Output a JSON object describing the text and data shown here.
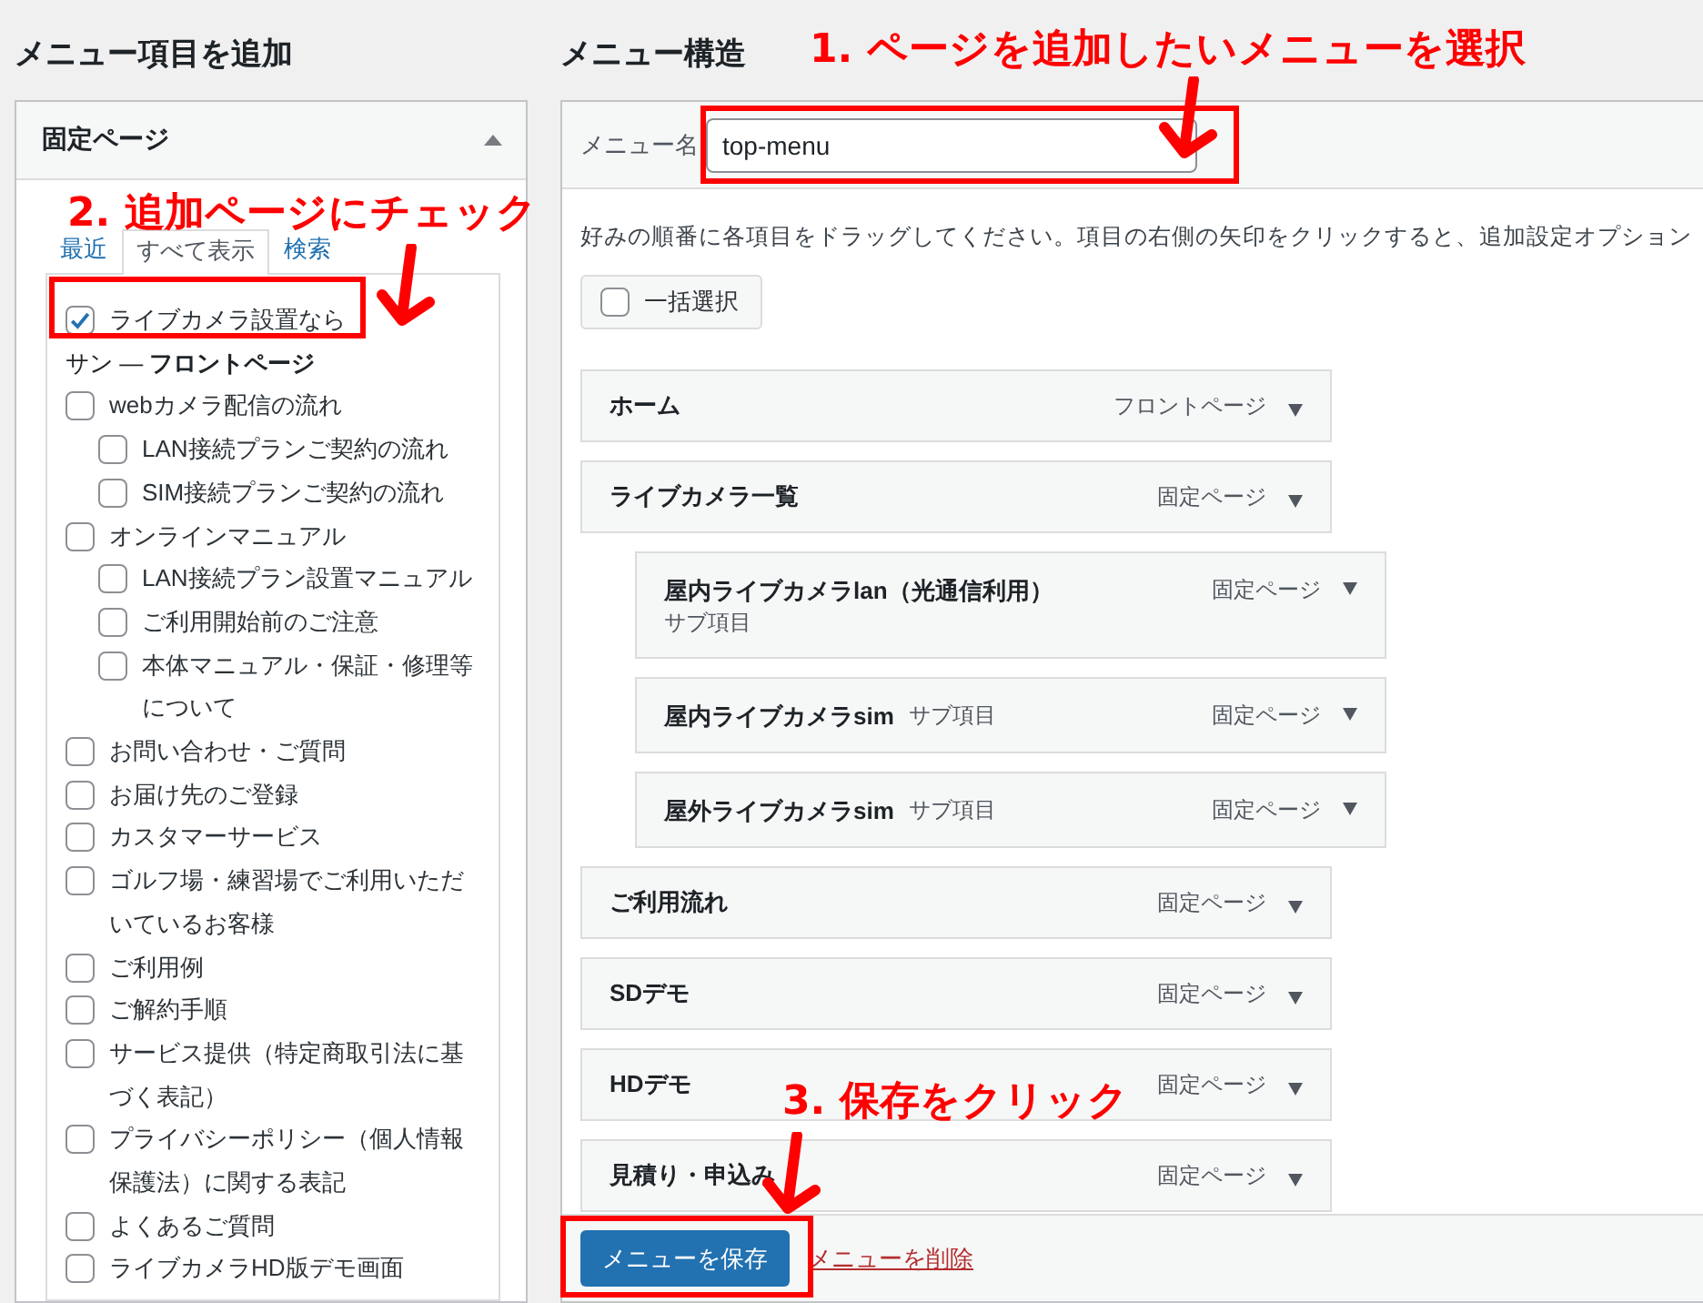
{
  "add_panel": {
    "heading": "メニュー項目を追加",
    "section": {
      "title": "固定ページ",
      "expanded": true
    },
    "tabs": [
      {
        "label": "最近",
        "selected": false
      },
      {
        "label": "すべて表示",
        "selected": true
      },
      {
        "label": "検索",
        "selected": false
      }
    ],
    "pages": [
      {
        "kind": "checkbox",
        "label": "ライブカメラ設置なら",
        "checked": true
      },
      {
        "kind": "note",
        "label": "サン — **フロントページ**"
      },
      {
        "kind": "checkbox",
        "label": "webカメラ配信の流れ",
        "checked": false,
        "children": [
          {
            "kind": "checkbox",
            "label": "LAN接続プランご契約の流れ",
            "checked": false
          },
          {
            "kind": "checkbox",
            "label": "SIM接続プランご契約の流れ",
            "checked": false
          }
        ]
      },
      {
        "kind": "checkbox",
        "label": "オンラインマニュアル",
        "checked": false,
        "children": [
          {
            "kind": "checkbox",
            "label": "LAN接続プラン設置マニュアル",
            "checked": false
          },
          {
            "kind": "checkbox",
            "label": "ご利用開始前のご注意",
            "checked": false
          },
          {
            "kind": "checkbox",
            "label": "本体マニュアル・保証・修理等について",
            "checked": false
          }
        ]
      },
      {
        "kind": "checkbox",
        "label": "お問い合わせ・ご質問",
        "checked": false
      },
      {
        "kind": "checkbox",
        "label": "お届け先のご登録",
        "checked": false
      },
      {
        "kind": "checkbox",
        "label": "カスタマーサービス",
        "checked": false
      },
      {
        "kind": "checkbox",
        "label": "ゴルフ場・練習場でご利用いただいているお客様",
        "checked": false
      },
      {
        "kind": "checkbox",
        "label": "ご利用例",
        "checked": false
      },
      {
        "kind": "checkbox",
        "label": "ご解約手順",
        "checked": false
      },
      {
        "kind": "checkbox",
        "label": "サービス提供（特定商取引法に基づく表記）",
        "checked": false
      },
      {
        "kind": "checkbox",
        "label": "プライバシーポリシー（個人情報保護法）に関する表記",
        "checked": false
      },
      {
        "kind": "checkbox",
        "label": "よくあるご質問",
        "checked": false
      },
      {
        "kind": "checkbox",
        "label": "ライブカメラHD版デモ画面",
        "checked": false
      }
    ]
  },
  "structure": {
    "heading": "メニュー構造",
    "menu_name_label": "メニュー名",
    "menu_name_value": "top-menu",
    "instructions": "好みの順番に各項目をドラッグしてください。項目の右側の矢印をクリックすると、追加設定オプション",
    "bulk_select": {
      "label": "一括選択",
      "checked": false
    },
    "items": [
      {
        "title": "ホーム",
        "type": "フロントページ"
      },
      {
        "title": "ライブカメラ一覧",
        "type": "固定ページ",
        "children": [
          {
            "title": "屋内ライブカメラlan（光通信利用）",
            "sub": "サブ項目",
            "type": "固定ページ"
          },
          {
            "title": "屋内ライブカメラsim",
            "sub": "サブ項目",
            "type": "固定ページ"
          },
          {
            "title": "屋外ライブカメラsim",
            "sub": "サブ項目",
            "type": "固定ページ"
          }
        ]
      },
      {
        "title": "ご利用流れ",
        "type": "固定ページ"
      },
      {
        "title": "SDデモ",
        "type": "固定ページ"
      },
      {
        "title": "HDデモ",
        "type": "固定ページ"
      },
      {
        "title": "見積り・申込み",
        "type": "固定ページ"
      }
    ],
    "save_button": "メニューを保存",
    "delete_link": "メニューを削除"
  },
  "annotations": [
    {
      "text": "1. ページを追加したいメニューを選択"
    },
    {
      "text": "2. 追加ページにチェック"
    },
    {
      "text": "3. 保存をクリック"
    }
  ]
}
